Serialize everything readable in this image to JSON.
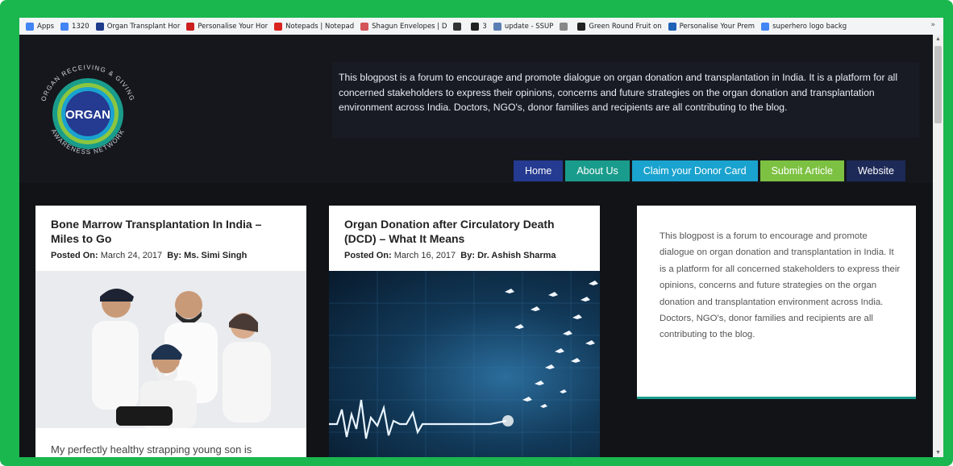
{
  "bookmarks": [
    {
      "label": "Apps",
      "icon": "apps-grid-icon",
      "color": "#4285f4"
    },
    {
      "label": "1320",
      "icon": "google-g-icon",
      "color": "#4285f4"
    },
    {
      "label": "Organ Transplant Hor",
      "icon": "site-icon",
      "color": "#1e3b8c"
    },
    {
      "label": "Personalise Your Hor",
      "icon": "triangle-icon",
      "color": "#cc1f1f"
    },
    {
      "label": "Notepads | Notepad",
      "icon": "stop-icon",
      "color": "#d9231e"
    },
    {
      "label": "Shagun Envelopes | D",
      "icon": "envelope-icon",
      "color": "#d4545a"
    },
    {
      "label": "",
      "icon": "camera-icon",
      "color": "#333333"
    },
    {
      "label": "3",
      "icon": "a-circle-icon",
      "color": "#222222"
    },
    {
      "label": "update - SSUP",
      "icon": "docs-icon",
      "color": "#5a7fb5"
    },
    {
      "label": "",
      "icon": "page-icon",
      "color": "#888888"
    },
    {
      "label": "Green Round Fruit on",
      "icon": "photo-icon",
      "color": "#222222"
    },
    {
      "label": "Personalise Your Prem",
      "icon": "triangle-icon",
      "color": "#1e63b8"
    },
    {
      "label": "superhero logo backg",
      "icon": "google-g-icon",
      "color": "#4285f4"
    }
  ],
  "bookmarks_more": "»",
  "logo": {
    "arc_top": "ORGAN RECEIVING & GIVING",
    "arc_bottom": "AWARENESS NETWORK",
    "center": "ORGAN"
  },
  "intro": "This blogpost is a forum to encourage and promote dialogue on organ donation and transplantation in India. It is a platform for all concerned stakeholders to express their opinions, concerns and future strategies on the organ donation and transplantation environment across India. Doctors, NGO's, donor families and recipients are all contributing to the blog.",
  "nav": [
    {
      "label": "Home",
      "color": "#253a91"
    },
    {
      "label": "About Us",
      "color": "#1a9c8c"
    },
    {
      "label": "Claim your Donor Card",
      "color": "#1aa3cf"
    },
    {
      "label": "Submit Article",
      "color": "#7dc142"
    },
    {
      "label": "Website",
      "color": "#1d2a57"
    }
  ],
  "posts": [
    {
      "title": "Bone Marrow Transplantation In India – Miles to Go",
      "posted_label": "Posted On:",
      "date": "March 24, 2017",
      "by_label": "By:",
      "author": "Ms. Simi Singh",
      "excerpt": "My perfectly healthy strapping young son is"
    },
    {
      "title": "Organ Donation after Circulatory Death (DCD) – What It Means",
      "posted_label": "Posted On:",
      "date": "March 16, 2017",
      "by_label": "By:",
      "author": "Dr. Ashish Sharma"
    }
  ],
  "sidebar_text": "This blogpost is a forum to encourage and promote dialogue on organ donation and transplantation in India. It is a platform for all concerned stakeholders to express their opinions, concerns and future strategies on the organ donation and transplantation environment across India. Doctors, NGO's, donor families and recipients are all contributing to the blog.",
  "colors": {
    "frame": "#1ab64e",
    "page_bg": "#0f1114",
    "accent_teal": "#1a9c8c"
  }
}
